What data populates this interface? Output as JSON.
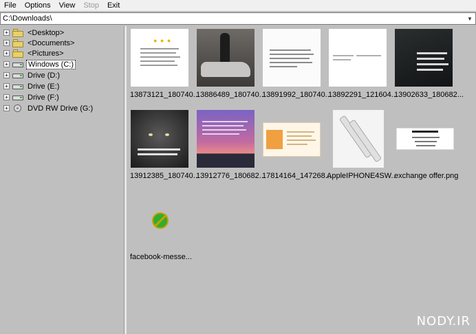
{
  "menu": {
    "file": "File",
    "options": "Options",
    "view": "View",
    "stop": "Stop",
    "exit": "Exit"
  },
  "path": {
    "value": "C:\\Downloads\\"
  },
  "tree": {
    "items": [
      {
        "label": "<Desktop>",
        "expander": "+",
        "icon": "folder-icon"
      },
      {
        "label": "<Documents>",
        "expander": "+",
        "icon": "folder-icon"
      },
      {
        "label": "<Pictures>",
        "expander": "+",
        "icon": "folder-icon"
      },
      {
        "label": "Windows (C:)",
        "expander": "+",
        "icon": "drive-icon",
        "selected": true
      },
      {
        "label": "Drive (D:)",
        "expander": "+",
        "icon": "drive-icon"
      },
      {
        "label": "Drive (E:)",
        "expander": "+",
        "icon": "drive-icon"
      },
      {
        "label": "Drive (F:)",
        "expander": "+",
        "icon": "drive-icon"
      },
      {
        "label": "DVD RW Drive (G:)",
        "expander": "+",
        "icon": "dvd-drive-icon"
      }
    ]
  },
  "files": [
    {
      "name": "13873121_180740..."
    },
    {
      "name": "13886489_180740..."
    },
    {
      "name": "13891992_180740..."
    },
    {
      "name": "13892291_121604..."
    },
    {
      "name": "13902633_180682..."
    },
    {
      "name": "13912385_180740..."
    },
    {
      "name": "13912776_180682..."
    },
    {
      "name": "17814164_147268..."
    },
    {
      "name": "AppleIPHONE4SW..."
    },
    {
      "name": "exchange offer.png"
    },
    {
      "name": "facebook-messe...",
      "icon": "no-preview-icon"
    }
  ],
  "watermark": {
    "title": "NODY.IR"
  }
}
